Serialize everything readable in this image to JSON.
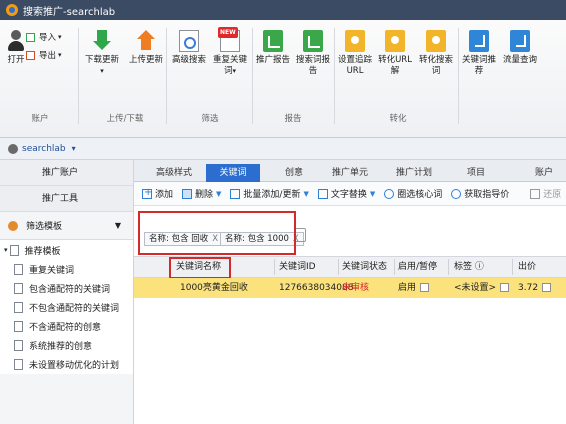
{
  "window": {
    "title": "搜索推广-searchlab"
  },
  "ribbon": {
    "open_label": "打开",
    "import_label": "导入",
    "export_label": "导出",
    "download_label": "下载更新",
    "upload_label": "上传更新",
    "adv_search_label": "高级搜索",
    "dup_kw_label": "重复关键词",
    "new_badge": "NEW",
    "promo_report_label": "推广报告",
    "search_word_report_label": "搜索词报告",
    "set_track_label": "设置追踪URL",
    "conv_url_label": "转化URL解",
    "conv_search_label": "转化搜索词",
    "kw_recommend_label": "关键词推荐",
    "traffic_query_label": "流量查询",
    "groups": {
      "account": "账户",
      "updown": "上传/下载",
      "filter": "筛选",
      "report": "报告",
      "conversion": "转化"
    }
  },
  "account_bar": {
    "name": "searchlab",
    "caret": "▾"
  },
  "sidebar": {
    "promo_account": "推广账户",
    "promo_tools": "推广工具",
    "filter_template": "筛选模板",
    "recommend_template": "推荐模板",
    "items": [
      "重复关键词",
      "包含通配符的关键词",
      "不包含通配符的关键词",
      "不含通配符的创意",
      "系统推荐的创意",
      "未设置移动优化的计划"
    ]
  },
  "tabs": [
    "高级样式",
    "关键词",
    "创意",
    "推广单元",
    "推广计划",
    "项目",
    "账户"
  ],
  "toolbar": {
    "add": "添加",
    "delete": "删除",
    "batch": "批量添加/更新",
    "replace": "文字替换",
    "core_words": "圈选核心词",
    "get_guide_price": "获取指导价",
    "restore": "还原"
  },
  "filters": [
    {
      "label": "名称: 包含 回收"
    },
    {
      "label": "名称: 包含 1000"
    }
  ],
  "table": {
    "headers": [
      "关键词名称",
      "关键词ID",
      "关键词状态",
      "启用/暂停",
      "标签 ⓘ",
      "出价"
    ],
    "rows": [
      {
        "name": "1000亮黄金回收",
        "id": "1276638034088",
        "status": "未审核",
        "enabled": "启用",
        "tag": "<未设置>",
        "bid": "3.72"
      }
    ]
  },
  "colors": {
    "titlebar": "#3b4b63",
    "accent": "#2c6dd0",
    "highlight_row": "#fbe27d",
    "annotation_red": "#d32a2a"
  }
}
